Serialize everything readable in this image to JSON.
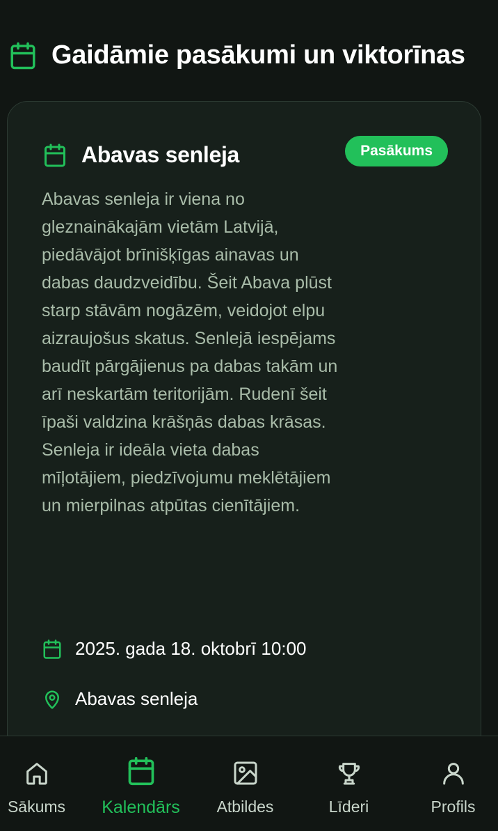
{
  "colors": {
    "accent": "#22c05a",
    "background": "#111613",
    "card": "#17201b",
    "muted_text": "#a9bca9"
  },
  "header": {
    "title": "Gaidāmie pasākumi un viktorīnas",
    "icon": "calendar-icon"
  },
  "event": {
    "title": "Abavas senleja",
    "badge": "Pasākums",
    "description": "Abavas senleja ir viena no gleznainākajām vietām Latvijā, piedāvājot brīnišķīgas ainavas un dabas daudzveidību. Šeit Abava plūst starp stāvām nogāzēm, veidojot elpu aizraujošus skatus. Senlejā iespējams baudīt pārgājienus pa dabas takām un arī neskartām teritorijām. Rudenī šeit īpaši valdzina krāšņās dabas krāsas. Senleja ir ideāla vieta dabas mīļotājiem, piedzīvojumu meklētājiem un mierpilnas atpūtas cienītājiem.",
    "date": "2025. gada 18. oktobrī 10:00",
    "location": "Abavas senleja"
  },
  "nav": {
    "items": [
      {
        "label": "Sākums",
        "icon": "home-icon"
      },
      {
        "label": "Kalendārs",
        "icon": "calendar-icon",
        "active": true
      },
      {
        "label": "Atbildes",
        "icon": "image-icon"
      },
      {
        "label": "Līderi",
        "icon": "trophy-icon"
      },
      {
        "label": "Profils",
        "icon": "user-icon"
      }
    ]
  }
}
